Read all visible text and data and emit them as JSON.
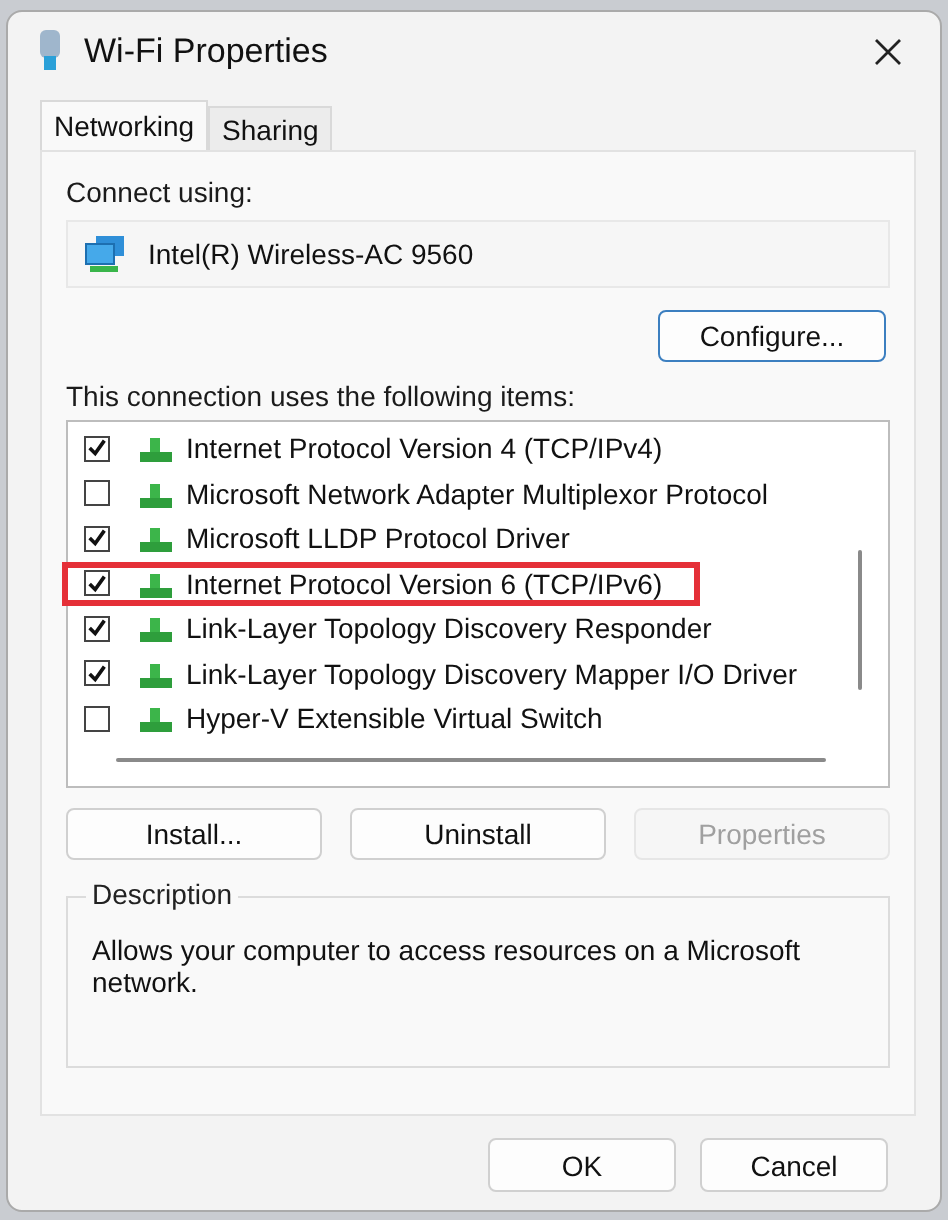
{
  "window": {
    "title": "Wi-Fi Properties"
  },
  "tabs": [
    {
      "label": "Networking",
      "selected": true
    },
    {
      "label": "Sharing",
      "selected": false
    }
  ],
  "connect_using": {
    "label": "Connect using:",
    "adapter": "Intel(R) Wireless-AC 9560",
    "configure_button": "Configure..."
  },
  "items_label": "This connection uses the following items:",
  "items": [
    {
      "label": "Internet Protocol Version 4 (TCP/IPv4)",
      "checked": true,
      "highlighted": false
    },
    {
      "label": "Microsoft Network Adapter Multiplexor Protocol",
      "checked": false,
      "highlighted": false
    },
    {
      "label": "Microsoft LLDP Protocol Driver",
      "checked": true,
      "highlighted": false
    },
    {
      "label": "Internet Protocol Version 6 (TCP/IPv6)",
      "checked": true,
      "highlighted": true
    },
    {
      "label": "Link-Layer Topology Discovery Responder",
      "checked": true,
      "highlighted": false
    },
    {
      "label": "Link-Layer Topology Discovery Mapper I/O Driver",
      "checked": true,
      "highlighted": false
    },
    {
      "label": "Hyper-V Extensible Virtual Switch",
      "checked": false,
      "highlighted": false
    }
  ],
  "item_buttons": [
    {
      "label": "Install...",
      "disabled": false
    },
    {
      "label": "Uninstall",
      "disabled": false
    },
    {
      "label": "Properties",
      "disabled": true
    }
  ],
  "description": {
    "title": "Description",
    "text": "Allows your computer to access resources on a Microsoft network."
  },
  "buttons": [
    "OK",
    "Cancel"
  ]
}
